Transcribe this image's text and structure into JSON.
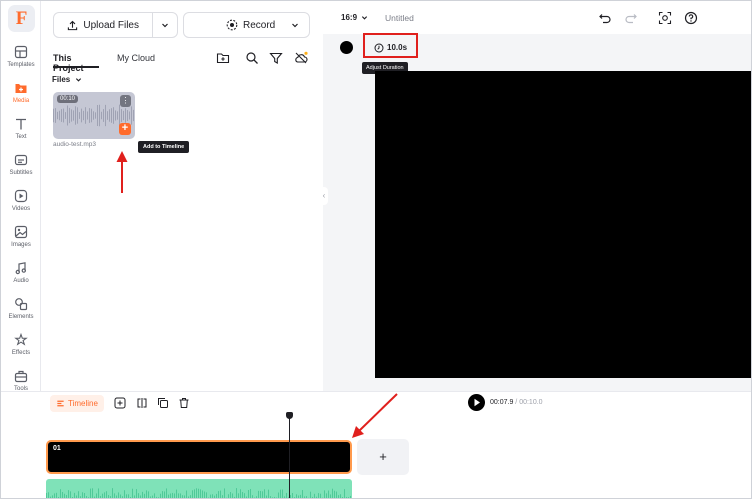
{
  "rail": {
    "logo": "F",
    "items": [
      {
        "label": "Templates"
      },
      {
        "label": "Media"
      },
      {
        "label": "Text"
      },
      {
        "label": "Subtitles"
      },
      {
        "label": "Videos"
      },
      {
        "label": "Images"
      },
      {
        "label": "Audio"
      },
      {
        "label": "Elements"
      },
      {
        "label": "Effects"
      },
      {
        "label": "Tools"
      }
    ],
    "active_item": "Media"
  },
  "panel": {
    "upload_label": "Upload Files",
    "record_label": "Record",
    "tabs": [
      {
        "label": "This Project",
        "active": true
      },
      {
        "label": "My Cloud",
        "active": false
      }
    ],
    "files_label": "Files",
    "file": {
      "duration": "00:10",
      "name": "audio-test.mp3",
      "add_tooltip": "Add to Timeline"
    }
  },
  "editor": {
    "aspect_ratio": "16:9",
    "title": "Untitled",
    "duration": "10.0s",
    "duration_tooltip": "Adjust Duration"
  },
  "timeline": {
    "tab_label": "Timeline",
    "current_time": "00:07.9",
    "separator": " / ",
    "total_time": "00:10.0",
    "clip_label": "01",
    "add_label": "+"
  },
  "colors": {
    "accent": "#ff6b2c",
    "annotation": "#e0201d",
    "audio_track": "#7fe2b8",
    "clip_border": "#ff9a4d"
  }
}
